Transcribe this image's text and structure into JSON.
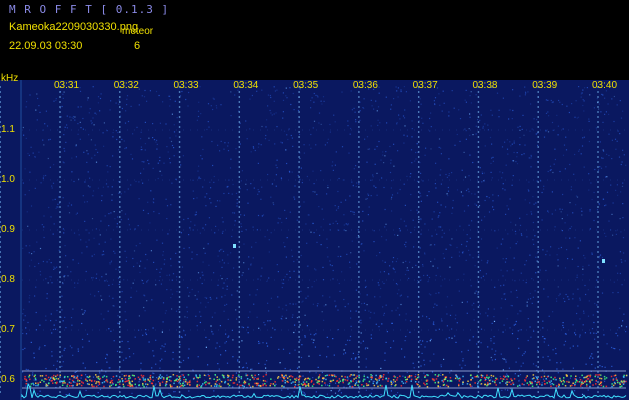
{
  "app": {
    "title": "M R O F F T  [ 0.1.3 ]"
  },
  "info": {
    "filename": "Kameoka2209030330.png",
    "meteor_label": "meteor",
    "datetime": "22.09.03  03:30",
    "meteor_count": "6"
  },
  "chart_data": {
    "type": "heatmap",
    "title": "",
    "ylabel": "kHz",
    "xlabel": "",
    "x_ticks": [
      "03:31",
      "03:32",
      "03:33",
      "03:34",
      "03:35",
      "03:36",
      "03:37",
      "03:38",
      "03:39",
      "03:40"
    ],
    "y_ticks": [
      "1.1",
      "1.0",
      "0.9",
      "0.8",
      "0.7",
      "0.6"
    ],
    "y_tick_values": [
      1.1,
      1.0,
      0.9,
      0.8,
      0.7,
      0.6
    ],
    "ylim": [
      0.58,
      1.2
    ],
    "xlim": [
      "03:30",
      "03:40"
    ],
    "grid": true,
    "colors": {
      "background": "#0a1860",
      "noise": "#2a5cd8",
      "hot": "#ff3030",
      "trace": "#40e0ff",
      "label": "#f0e000"
    }
  }
}
